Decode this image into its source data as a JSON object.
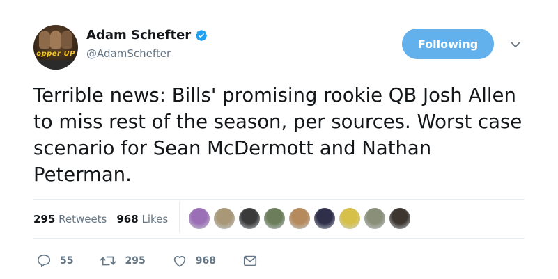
{
  "user": {
    "display_name": "Adam Schefter",
    "handle": "@AdamSchefter",
    "avatar_logo_text": "opper UP",
    "verified": true
  },
  "follow_button": {
    "label": "Following"
  },
  "tweet": {
    "text": "Terrible news: Bills' promising rookie QB Josh Allen to miss rest of the season, per sources. Worst case scenario for Sean McDermott and Nathan Peterman."
  },
  "stats": {
    "retweets_count": "295",
    "retweets_label": "Retweets",
    "likes_count": "968",
    "likes_label": "Likes"
  },
  "liker_avatars": [
    {
      "color": "#9b6fb5"
    },
    {
      "color": "#a89878"
    },
    {
      "color": "#3a3a3a"
    },
    {
      "color": "#6b7d5a"
    },
    {
      "color": "#b58a5c"
    },
    {
      "color": "#2f2f4a"
    },
    {
      "color": "#d6c04a"
    },
    {
      "color": "#8a8f7a"
    },
    {
      "color": "#3c3530"
    }
  ],
  "actions": {
    "reply_count": "55",
    "retweet_count": "295",
    "like_count": "968"
  },
  "colors": {
    "accent": "#62b0ec",
    "text": "#14171a",
    "muted": "#657786",
    "verified": "#1da1f2"
  }
}
